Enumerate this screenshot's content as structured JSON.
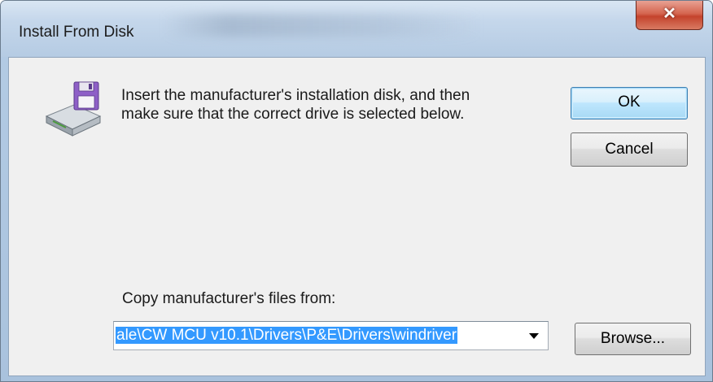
{
  "window": {
    "title": "Install From Disk",
    "close_glyph": "✕"
  },
  "message": {
    "line1": "Insert the manufacturer's installation disk, and then",
    "line2": "make sure that the correct drive is selected below."
  },
  "buttons": {
    "ok_label": "OK",
    "cancel_label": "Cancel",
    "browse_label": "Browse..."
  },
  "copy_from": {
    "label": "Copy manufacturer's files from:",
    "value": "ale\\CW MCU v10.1\\Drivers\\P&E\\Drivers\\windriver"
  },
  "icons": {
    "disk": "floppy-disk-drive-icon",
    "dropdown": "chevron-down-icon"
  },
  "colors": {
    "selection": "#3399ff",
    "close_button": "#c4432c",
    "default_button_border": "#3c7fb1"
  }
}
